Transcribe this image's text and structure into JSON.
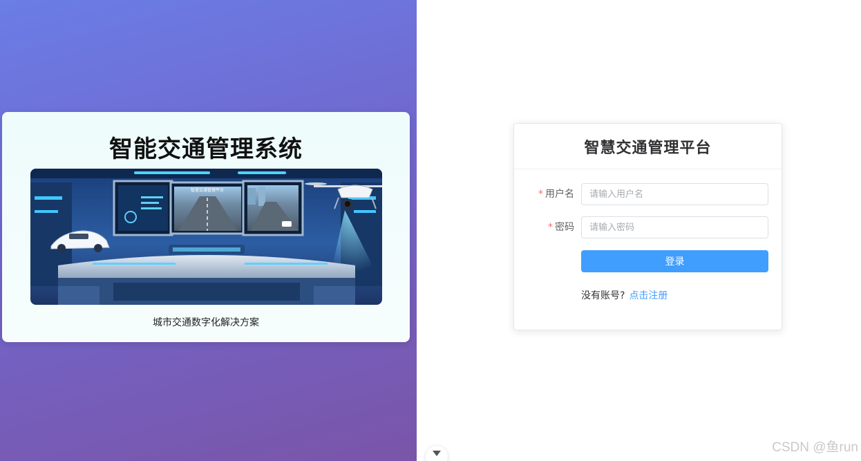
{
  "promo": {
    "title": "智能交通管理系统",
    "screen_text": "智慧交通管理平台",
    "caption": "城市交通数字化解决方案"
  },
  "login": {
    "title": "智慧交通管理平台",
    "username_label": "用户名",
    "username_placeholder": "请输入用户名",
    "username_value": "",
    "password_label": "密码",
    "password_placeholder": "请输入密码",
    "password_value": "",
    "required_mark": "*",
    "submit_label": "登录",
    "register_prompt": "没有账号?",
    "register_link": "点击注册"
  },
  "watermark": "CSDN @鱼run",
  "colors": {
    "primary": "#409eff",
    "required": "#f56c6c",
    "gradient_start": "#6a7ee6",
    "gradient_end": "#7a55a8"
  },
  "icons": {
    "toggle": "chevron-down-icon"
  }
}
